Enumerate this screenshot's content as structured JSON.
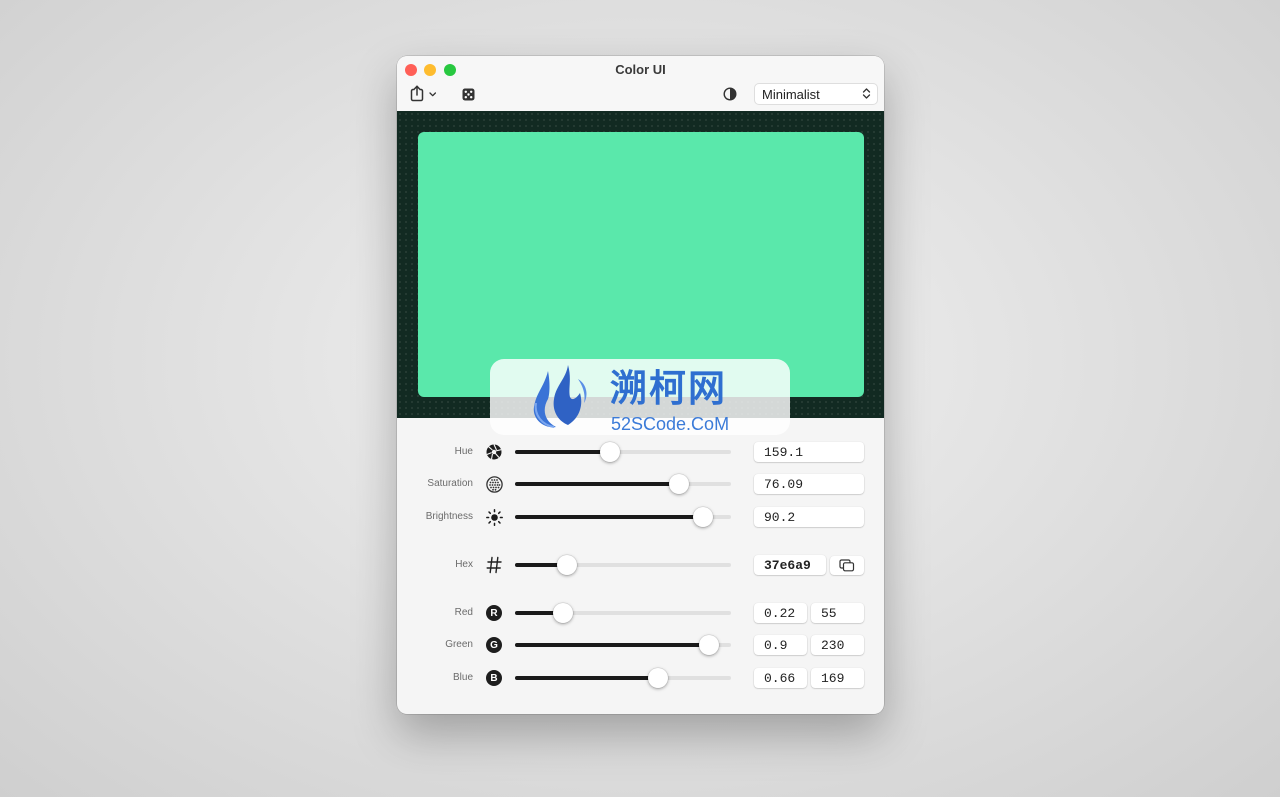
{
  "window": {
    "title": "Color UI",
    "style_select": {
      "value": "Minimalist"
    },
    "toolbar": {
      "share_icon": "share-icon",
      "random_icon": "dice-icon",
      "appearance_icon": "contrast-icon"
    }
  },
  "preview": {
    "color": "#37e6a9",
    "display_color": "#5ae8ab",
    "background": "#122a22"
  },
  "controls": {
    "hue": {
      "label": "Hue",
      "value": "159.1",
      "fraction": 0.44,
      "icon": "aperture-icon"
    },
    "saturation": {
      "label": "Saturation",
      "value": "76.09",
      "fraction": 0.7609,
      "icon": "dotted-circle-icon"
    },
    "brightness": {
      "label": "Brightness",
      "value": "90.2",
      "fraction": 0.87,
      "icon": "sun-icon"
    },
    "hex": {
      "label": "Hex",
      "value": "37e6a9",
      "fraction": 0.24,
      "icon": "hash-icon"
    },
    "red": {
      "label": "Red",
      "badge": "R",
      "fraction": "0.22",
      "value": "55"
    },
    "green": {
      "label": "Green",
      "badge": "G",
      "fraction": "0.9",
      "value": "230"
    },
    "blue": {
      "label": "Blue",
      "badge": "B",
      "fraction": "0.66",
      "value": "169"
    }
  },
  "watermark": {
    "cn": "溯柯网",
    "en": "52SCode.CoM"
  }
}
